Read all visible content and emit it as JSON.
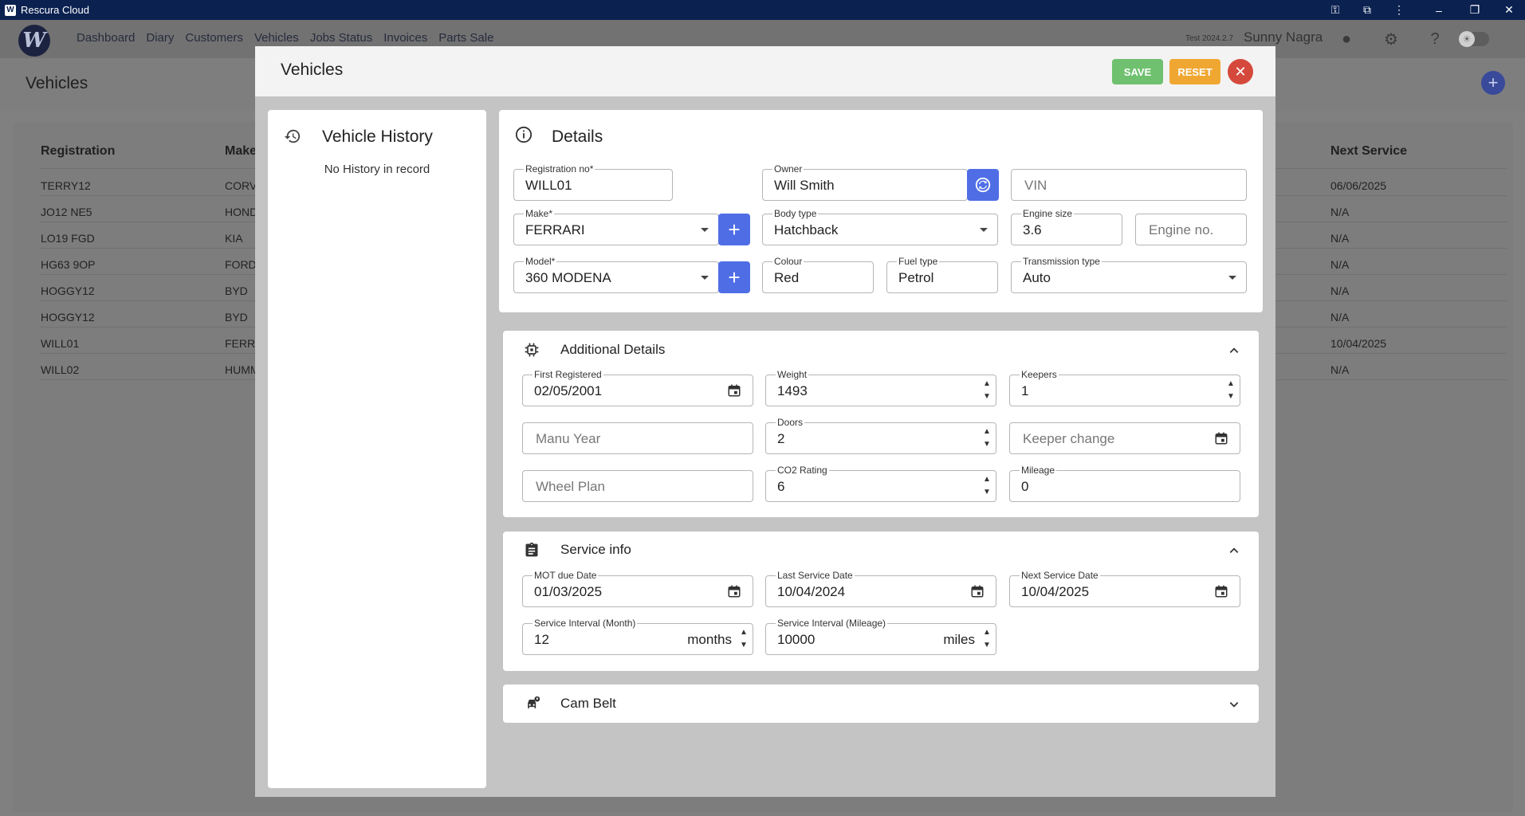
{
  "window": {
    "title": "Rescura Cloud"
  },
  "nav": [
    "Dashboard",
    "Diary",
    "Customers",
    "Vehicles",
    "Jobs Status",
    "Invoices",
    "Parts Sale"
  ],
  "user": {
    "version": "Test 2024.2.7",
    "name": "Sunny Nagra"
  },
  "page": {
    "title": "Vehicles"
  },
  "table": {
    "headers": [
      "Registration",
      "Make",
      "Next Service"
    ],
    "rows": [
      {
        "reg": "TERRY12",
        "make": "CORV",
        "next": "06/06/2025"
      },
      {
        "reg": "JO12 NE5",
        "make": "HOND",
        "next": "N/A"
      },
      {
        "reg": "LO19 FGD",
        "make": "KIA",
        "next": "N/A"
      },
      {
        "reg": "HG63 9OP",
        "make": "FORD",
        "next": "N/A"
      },
      {
        "reg": "HOGGY12",
        "make": "BYD",
        "next": "N/A"
      },
      {
        "reg": "HOGGY12",
        "make": "BYD",
        "next": "N/A"
      },
      {
        "reg": "WILL01",
        "make": "FERR",
        "next": "10/04/2025"
      },
      {
        "reg": "WILL02",
        "make": "HUMM",
        "next": "N/A"
      }
    ]
  },
  "modal": {
    "title": "Vehicles",
    "save_label": "SAVE",
    "reset_label": "RESET",
    "history": {
      "title": "Vehicle History",
      "empty": "No History in record"
    },
    "details": {
      "title": "Details",
      "registration": {
        "label": "Registration no*",
        "value": "WILL01"
      },
      "owner": {
        "label": "Owner",
        "value": "Will Smith"
      },
      "vin": {
        "placeholder": "VIN"
      },
      "make": {
        "label": "Make*",
        "value": "FERRARI"
      },
      "body_type": {
        "label": "Body type",
        "value": "Hatchback"
      },
      "engine_size": {
        "label": "Engine size",
        "value": "3.6"
      },
      "engine_no": {
        "placeholder": "Engine no."
      },
      "model": {
        "label": "Model*",
        "value": "360 MODENA"
      },
      "colour": {
        "label": "Colour",
        "value": "Red"
      },
      "fuel_type": {
        "label": "Fuel type",
        "value": "Petrol"
      },
      "transmission": {
        "label": "Transmission type",
        "value": "Auto"
      }
    },
    "additional": {
      "title": "Additional Details",
      "first_registered": {
        "label": "First Registered",
        "value": "02/05/2001"
      },
      "weight": {
        "label": "Weight",
        "value": "1493"
      },
      "keepers": {
        "label": "Keepers",
        "value": "1"
      },
      "manu_year": {
        "placeholder": "Manu Year"
      },
      "doors": {
        "label": "Doors",
        "value": "2"
      },
      "keeper_change": {
        "placeholder": "Keeper change"
      },
      "wheel_plan": {
        "placeholder": "Wheel Plan"
      },
      "co2": {
        "label": "CO2 Rating",
        "value": "6"
      },
      "mileage": {
        "label": "Mileage",
        "value": "0"
      }
    },
    "service": {
      "title": "Service info",
      "mot_due": {
        "label": "MOT due Date",
        "value": "01/03/2025"
      },
      "last_service": {
        "label": "Last Service Date",
        "value": "10/04/2024"
      },
      "next_service": {
        "label": "Next Service Date",
        "value": "10/04/2025"
      },
      "interval_month": {
        "label": "Service Interval (Month)",
        "value": "12",
        "unit": "months"
      },
      "interval_mileage": {
        "label": "Service Interval (Mileage)",
        "value": "10000",
        "unit": "miles"
      }
    },
    "cambelt": {
      "title": "Cam Belt"
    }
  },
  "colors": {
    "primary": "#4f6ee6",
    "save": "#6fc06f",
    "reset": "#f0a732",
    "close": "#d5493c",
    "titlebar": "#0b2150"
  }
}
